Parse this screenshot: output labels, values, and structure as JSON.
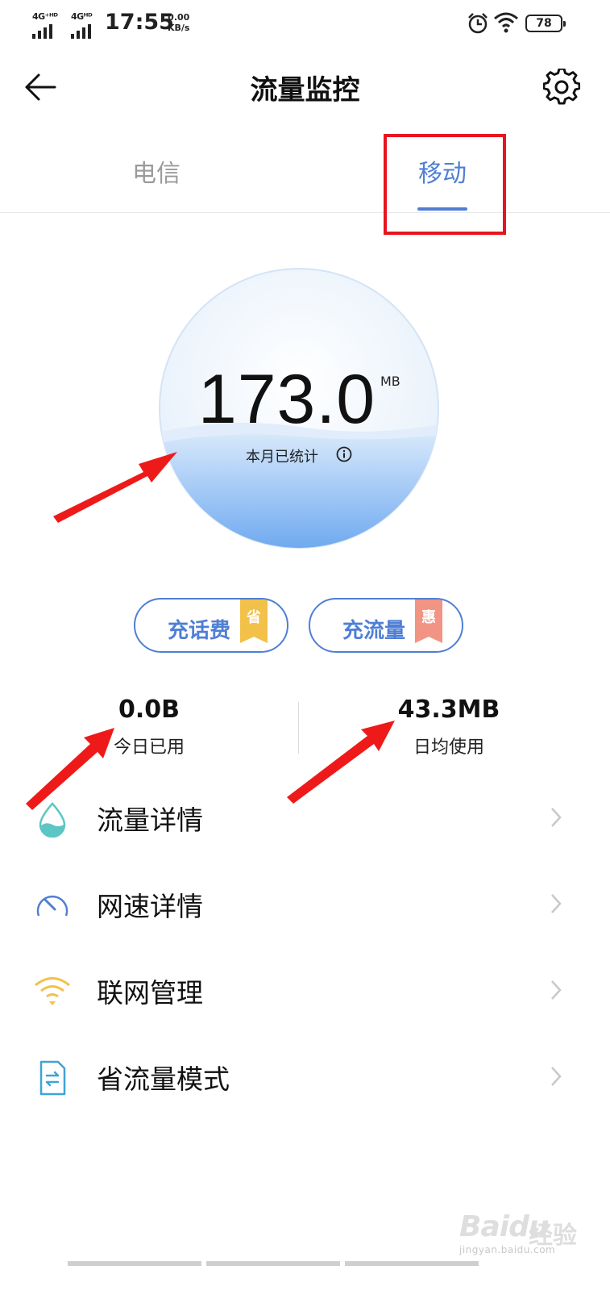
{
  "status_bar": {
    "net1": "4G⁺ᴴᴰ",
    "net2": "4Gᴴᴰ",
    "time": "17:55",
    "speed_value": "0.00",
    "speed_unit": "KB/s",
    "battery": "78"
  },
  "header": {
    "title": "流量监控"
  },
  "tabs": [
    {
      "label": "电信",
      "active": false
    },
    {
      "label": "移动",
      "active": true
    }
  ],
  "usage": {
    "value": "173.0",
    "unit": "MB",
    "caption": "本月已统计"
  },
  "actions": [
    {
      "label": "充话费",
      "badge": "省",
      "badge_color": "#f2c14a"
    },
    {
      "label": "充流量",
      "badge": "惠",
      "badge_color": "#f29483"
    }
  ],
  "stats": [
    {
      "value": "0.0B",
      "label": "今日已用"
    },
    {
      "value": "43.3MB",
      "label": "日均使用"
    }
  ],
  "menu": [
    {
      "label": "流量详情",
      "icon": "water-drop-icon"
    },
    {
      "label": "网速详情",
      "icon": "speedometer-icon"
    },
    {
      "label": "联网管理",
      "icon": "wifi-icon"
    },
    {
      "label": "省流量模式",
      "icon": "document-swap-icon"
    }
  ],
  "watermark": {
    "brand": "Baidu",
    "brand_cn": "经验",
    "site": "jingyan.baidu.com"
  },
  "colors": {
    "accent": "#4f7fd4",
    "annotation_red": "#e8141f"
  }
}
